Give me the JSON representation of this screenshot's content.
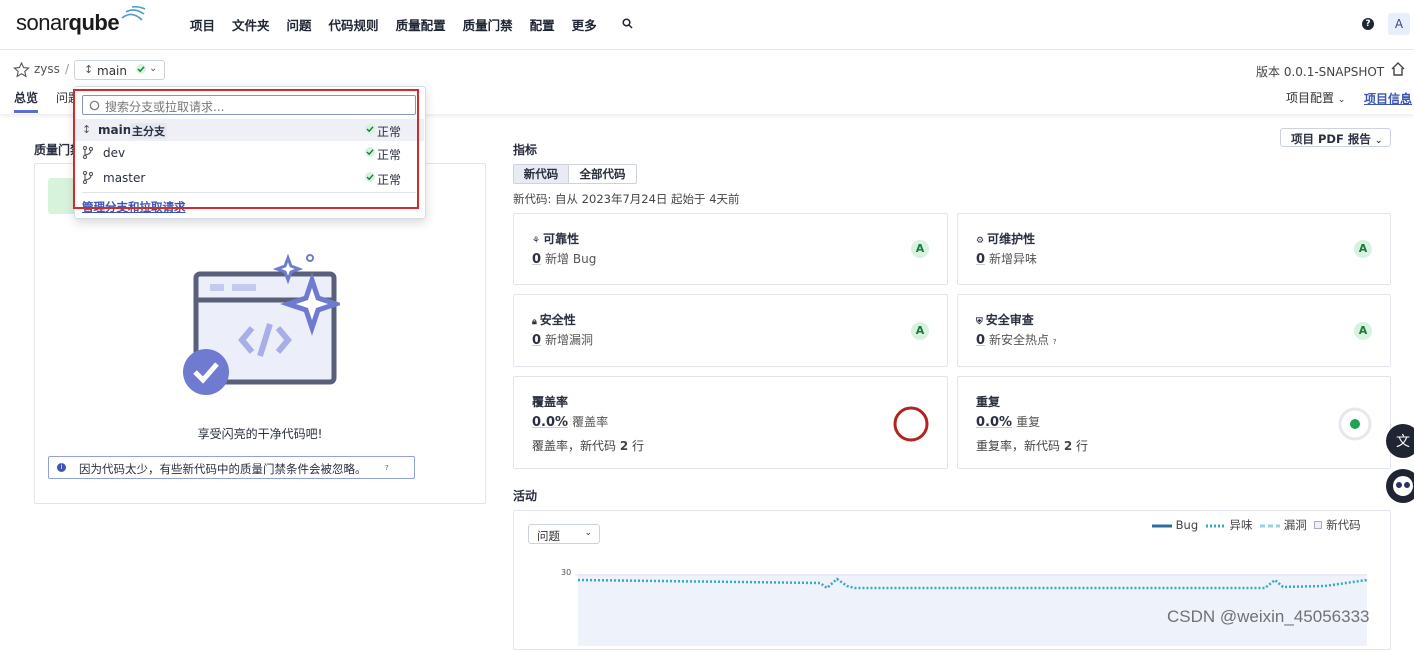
{
  "app": {
    "logo_light": "sonar",
    "logo_bold": "qube"
  },
  "nav": {
    "items": [
      "项目",
      "文件夹",
      "问题",
      "代码规则",
      "质量配置",
      "质量门禁",
      "配置",
      "更多"
    ],
    "user_initial": "A",
    "help": "?"
  },
  "project": {
    "name": "zyss",
    "branch": "main",
    "version": "版本 0.0.1-SNAPSHOT"
  },
  "tabs": {
    "overview": "总览",
    "issues": "问题",
    "config": "项目配置",
    "info": "项目信息"
  },
  "quality_gate": {
    "title": "质量门禁",
    "clean_message": "享受闪亮的干净代码吧!",
    "info_message": "因为代码太少，有些新代码中的质量门禁条件会被忽略。"
  },
  "metrics": {
    "title": "指标",
    "pdf_button": "项目 PDF 报告",
    "new_code_tab": "新代码",
    "all_code_tab": "全部代码",
    "new_code_desc": "新代码: 自从 2023年7月24日 起始于 4天前",
    "reliability": {
      "title": "可靠性",
      "value": "0",
      "label": "新增 Bug",
      "grade": "A"
    },
    "maintainability": {
      "title": "可维护性",
      "value": "0",
      "label": "新增异味",
      "grade": "A"
    },
    "security": {
      "title": "安全性",
      "value": "0",
      "label": "新增漏洞",
      "grade": "A"
    },
    "security_review": {
      "title": "安全审查",
      "value": "0",
      "label": "新安全热点",
      "grade": "A"
    },
    "coverage": {
      "title": "覆盖率",
      "value": "0.0%",
      "label": "覆盖率",
      "sub_prefix": "覆盖率，新代码",
      "sub_count": "2",
      "sub_suffix": "行"
    },
    "duplication": {
      "title": "重复",
      "value": "0.0%",
      "label": "重复",
      "sub_prefix": "重复率，新代码",
      "sub_count": "2",
      "sub_suffix": "行"
    }
  },
  "activity": {
    "title": "活动",
    "select_value": "问题",
    "legend": [
      "Bug",
      "异味",
      "漏洞",
      "新代码"
    ],
    "y_tick": "30"
  },
  "branch_dropdown": {
    "search_placeholder": "搜索分支或拉取请求...",
    "main_tag": "主分支",
    "branches": [
      {
        "name": "main",
        "status": "正常"
      },
      {
        "name": "dev",
        "status": "正常"
      },
      {
        "name": "master",
        "status": "正常"
      }
    ],
    "manage_link": "管理分支和拉取请求"
  },
  "watermark": "CSDN @weixin_45056333",
  "colors": {
    "accent": "#5d6cd0",
    "link": "#3d55b6",
    "grade_bg": "#d7f2de",
    "highlight": "#d42a2a"
  }
}
